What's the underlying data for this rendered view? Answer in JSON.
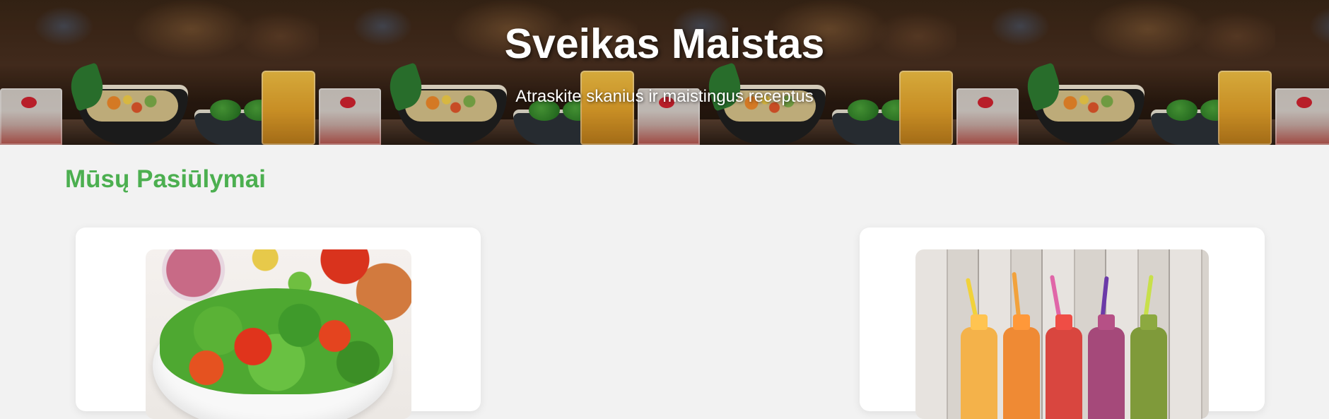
{
  "hero": {
    "title": "Sveikas Maistas",
    "subtitle": "Atraskite skanius ir maistingus receptus"
  },
  "offers": {
    "title": "Mūsų Pasiūlymai",
    "cards": [
      {
        "image": "salad-image"
      },
      {
        "image": "smoothies-image"
      }
    ]
  },
  "colors": {
    "accent": "#4caf50",
    "background": "#f2f2f2",
    "card": "#ffffff"
  }
}
